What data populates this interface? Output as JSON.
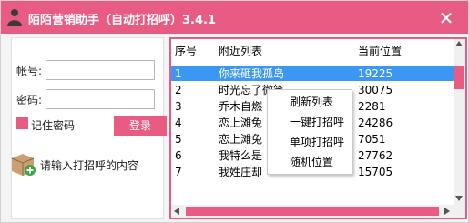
{
  "window": {
    "title": "陌陌营销助手（自动打招呼）3.4.1",
    "close_glyph": "✕",
    "app_icon": "person-silhouette-icon"
  },
  "login": {
    "account_label": "帐号:",
    "account_value": "",
    "password_label": "密码:",
    "password_value": "",
    "remember_label": "记住密码",
    "remember_checked": true,
    "login_button": "登录",
    "greeting_icon": "package-add-icon",
    "greeting_label": "请输入打招呼的内容"
  },
  "table": {
    "columns": [
      "序号",
      "附近列表",
      "当前位置"
    ],
    "rows": [
      {
        "index": "1",
        "name": "你来砸我孤岛",
        "location": "19225",
        "selected": true
      },
      {
        "index": "2",
        "name": "时光忘了微笑",
        "location": "30075",
        "selected": false
      },
      {
        "index": "3",
        "name": "乔木自燃",
        "location": "2281",
        "selected": false
      },
      {
        "index": "4",
        "name": "恋上滩兔",
        "location": "24286",
        "selected": false
      },
      {
        "index": "5",
        "name": "恋上滩兔",
        "location": "7051",
        "selected": false
      },
      {
        "index": "6",
        "name": "我特么是",
        "location": "27762",
        "selected": false
      },
      {
        "index": "7",
        "name": "我姓庄却",
        "location": "15705",
        "selected": false
      }
    ]
  },
  "context_menu": {
    "items": [
      "刷新列表",
      "一键打招呼",
      "单项打招呼",
      "随机位置"
    ]
  },
  "colors": {
    "accent": "#e85b82",
    "selection": "#3a97f4"
  }
}
